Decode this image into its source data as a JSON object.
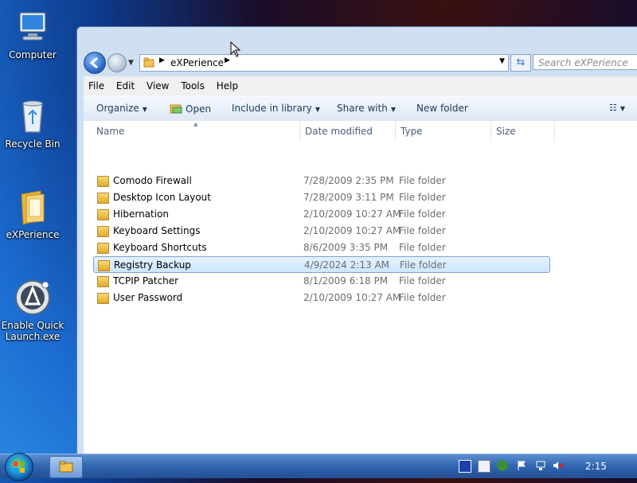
{
  "desktop": {
    "icons": [
      {
        "label": "Computer"
      },
      {
        "label": "Recycle Bin"
      },
      {
        "label": "eXPerience"
      },
      {
        "label": "Enable Quick\nLaunch.exe"
      }
    ]
  },
  "explorer": {
    "address_crumb": "eXPerience",
    "search_placeholder": "Search eXPerience",
    "menu": [
      "File",
      "Edit",
      "View",
      "Tools",
      "Help"
    ],
    "toolbar": {
      "organize": "Organize",
      "open": "Open",
      "include": "Include in library",
      "share": "Share with",
      "new_folder": "New folder"
    },
    "columns": {
      "name": "Name",
      "date": "Date modified",
      "type": "Type",
      "size": "Size"
    },
    "rows": [
      {
        "name": "Comodo Firewall",
        "date": "7/28/2009 2:35 PM",
        "type": "File folder"
      },
      {
        "name": "Desktop Icon Layout",
        "date": "7/28/2009 3:11 PM",
        "type": "File folder"
      },
      {
        "name": "Hibernation",
        "date": "2/10/2009 10:27 AM",
        "type": "File folder"
      },
      {
        "name": "Keyboard Settings",
        "date": "2/10/2009 10:27 AM",
        "type": "File folder"
      },
      {
        "name": "Keyboard Shortcuts",
        "date": "8/6/2009 3:35 PM",
        "type": "File folder"
      },
      {
        "name": "Registry Backup",
        "date": "4/9/2024 2:13 AM",
        "type": "File folder"
      },
      {
        "name": "TCPIP Patcher",
        "date": "8/1/2009 6:18 PM",
        "type": "File folder"
      },
      {
        "name": "User Password",
        "date": "2/10/2009 10:27 AM",
        "type": "File folder"
      }
    ],
    "selected_row": "Registry Backup"
  },
  "taskbar": {
    "clock": "2:15"
  }
}
